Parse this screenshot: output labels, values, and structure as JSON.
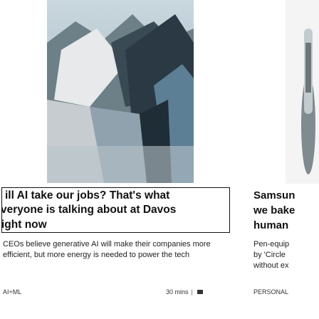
{
  "main_card": {
    "headline_lines": [
      "ill AI take our jobs? That's what",
      "veryone is talking about at Davos",
      "ight now"
    ],
    "description": "CEOs believe generative AI will make their companies more efficient, but more energy is needed to power the tech",
    "tag": "AI+ML",
    "read_time": "30 mins",
    "separator": "|",
    "bookmark_icon": "bookmark-icon"
  },
  "side_card": {
    "title_lines": [
      "Samsun",
      "we bake",
      "human"
    ],
    "description_lines": [
      "Pen-equip",
      "by 'Circle",
      "without ex"
    ],
    "tag": "PERSONAL"
  }
}
